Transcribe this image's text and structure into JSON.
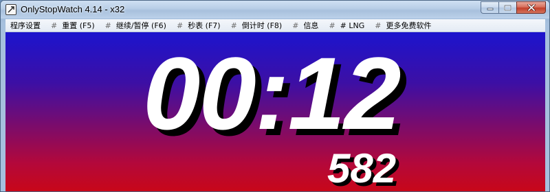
{
  "window": {
    "title": "OnlyStopWatch 4.14 - x32",
    "icon": "stopwatch-app-icon",
    "controls": {
      "minimize_icon": "minimize-icon",
      "maximize_icon": "maximize-icon",
      "close_icon": "close-icon"
    }
  },
  "menu": {
    "separator": "#",
    "items": [
      {
        "label": "程序设置"
      },
      {
        "label": "重置 (F5)"
      },
      {
        "label": "继续/暂停 (F6)"
      },
      {
        "label": "秒表 (F7)"
      },
      {
        "label": "倒计时 (F8)"
      },
      {
        "label": "信息"
      },
      {
        "label": "# LNG"
      },
      {
        "label": "更多免费软件"
      }
    ]
  },
  "display": {
    "time": "00:12",
    "milliseconds": "582",
    "colors": {
      "gradient_top": "#1c14ce",
      "gradient_bottom": "#c90717",
      "digits": "#ffffff",
      "shadow": "#000000"
    }
  }
}
